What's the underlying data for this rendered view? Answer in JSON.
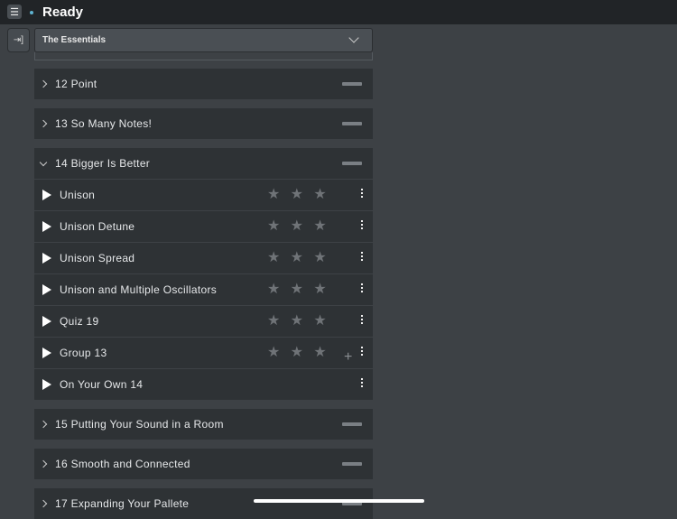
{
  "header": {
    "title": "Ready",
    "menu_icon": "hamburger-icon"
  },
  "library": {
    "selected": "The Essentials"
  },
  "sections": [
    {
      "label": "12 Point",
      "expanded": false
    },
    {
      "label": "13 So Many Notes!",
      "expanded": false
    },
    {
      "label": "14 Bigger Is Better",
      "expanded": true,
      "items": [
        {
          "label": "Unison",
          "stars": 0,
          "has_rating": true
        },
        {
          "label": "Unison Detune",
          "stars": 0,
          "has_rating": true
        },
        {
          "label": "Unison Spread",
          "stars": 0,
          "has_rating": true
        },
        {
          "label": "Unison and Multiple Oscillators",
          "stars": 0,
          "has_rating": true
        },
        {
          "label": "Quiz 19",
          "stars": 0,
          "has_rating": true
        },
        {
          "label": "Group 13",
          "stars": 0,
          "has_rating": true,
          "plus": "+"
        },
        {
          "label": "On Your Own 14",
          "has_rating": false
        }
      ]
    },
    {
      "label": "15 Putting Your Sound in a Room",
      "expanded": false
    },
    {
      "label": "16 Smooth and Connected",
      "expanded": false
    },
    {
      "label": "17 Expanding Your Pallete",
      "expanded": false
    }
  ]
}
